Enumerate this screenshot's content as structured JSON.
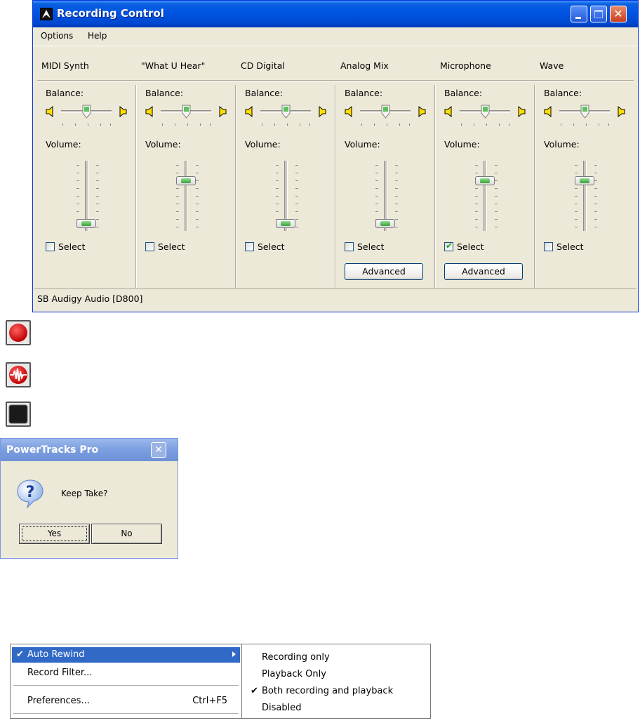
{
  "recording_control": {
    "title": "Recording Control",
    "menus": [
      "Options",
      "Help"
    ],
    "channels": [
      {
        "name": "MIDI Synth",
        "balance_label": "Balance:",
        "volume_label": "Volume:",
        "volume_level": 0.05,
        "select_label": "Select",
        "selected": false
      },
      {
        "name": "\"What U Hear\"",
        "balance_label": "Balance:",
        "volume_label": "Volume:",
        "volume_level": 0.75,
        "select_label": "Select",
        "selected": false
      },
      {
        "name": "CD Digital",
        "balance_label": "Balance:",
        "volume_label": "Volume:",
        "volume_level": 0.05,
        "select_label": "Select",
        "selected": false
      },
      {
        "name": "Analog Mix",
        "balance_label": "Balance:",
        "volume_label": "Volume:",
        "volume_level": 0.05,
        "select_label": "Select",
        "selected": false,
        "advanced_label": "Advanced"
      },
      {
        "name": "Microphone",
        "balance_label": "Balance:",
        "volume_label": "Volume:",
        "volume_level": 0.75,
        "select_label": "Select",
        "selected": true,
        "advanced_label": "Advanced"
      },
      {
        "name": "Wave",
        "balance_label": "Balance:",
        "volume_label": "Volume:",
        "volume_level": 0.75,
        "select_label": "Select",
        "selected": false
      }
    ],
    "status": "SB Audigy Audio [D800]"
  },
  "transport_icons": [
    "record-icon",
    "waveform-record-icon",
    "stop-icon"
  ],
  "dialog": {
    "title": "PowerTracks Pro",
    "message": "Keep Take?",
    "yes_label": "Yes",
    "no_label": "No"
  },
  "menu": {
    "items": [
      {
        "label": "Auto Rewind",
        "checked": true,
        "submenu": true
      },
      {
        "label": "Record Filter...",
        "checked": false
      },
      {
        "label": "Preferences...",
        "shortcut": "Ctrl+F5",
        "checked": false
      }
    ],
    "submenu_items": [
      {
        "label": "Recording only",
        "checked": false
      },
      {
        "label": "Playback Only",
        "checked": false
      },
      {
        "label": "Both recording and playback",
        "checked": true
      },
      {
        "label": "Disabled",
        "checked": false
      }
    ]
  },
  "colors": {
    "xp_blue": "#0054e3",
    "window_face": "#ece9d8",
    "menu_highlight": "#3169c6",
    "record_red": "#e00000"
  }
}
